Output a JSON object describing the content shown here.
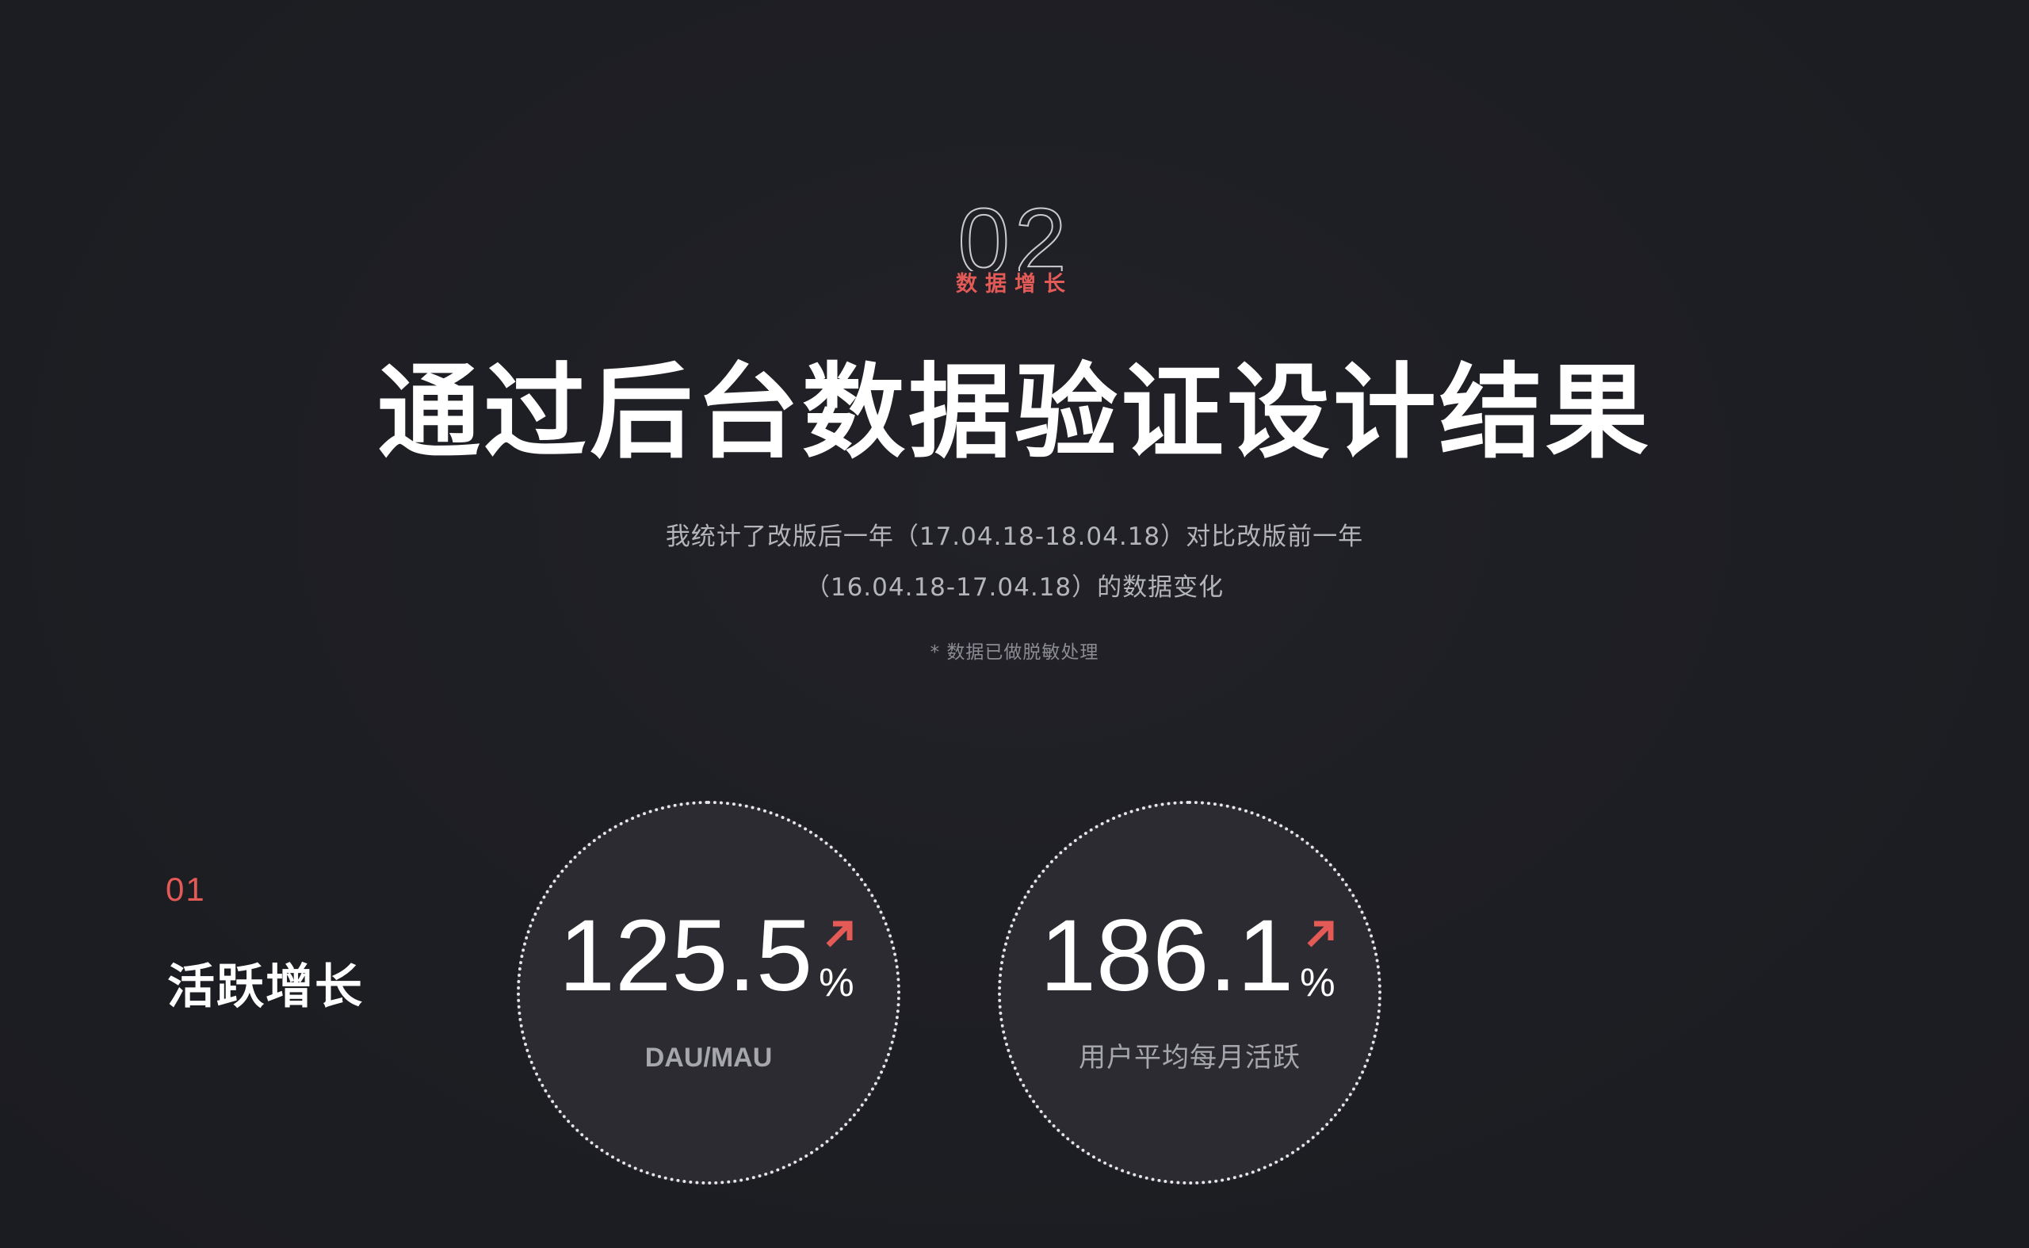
{
  "section": {
    "number": "02",
    "tag": "数据增长"
  },
  "title": "通过后台数据验证设计结果",
  "description": {
    "line1": "我统计了改版后一年（17.04.18-18.04.18）对比改版前一年",
    "line2": "（16.04.18-17.04.18）的数据变化"
  },
  "note": "* 数据已做脱敏处理",
  "subsection": {
    "number": "01",
    "title": "活跃增长"
  },
  "stats": [
    {
      "value": "125.5",
      "unit": "%",
      "trend_icon": "arrow-up-right-icon",
      "label": "DAU/MAU"
    },
    {
      "value": "186.1",
      "unit": "%",
      "trend_icon": "arrow-up-right-icon",
      "label": "用户平均每月活跃"
    }
  ],
  "colors": {
    "background": "#1d1e23",
    "accent": "#e45a57",
    "circle_fill": "#2b2b31",
    "muted_text": "#b4b4bb"
  }
}
